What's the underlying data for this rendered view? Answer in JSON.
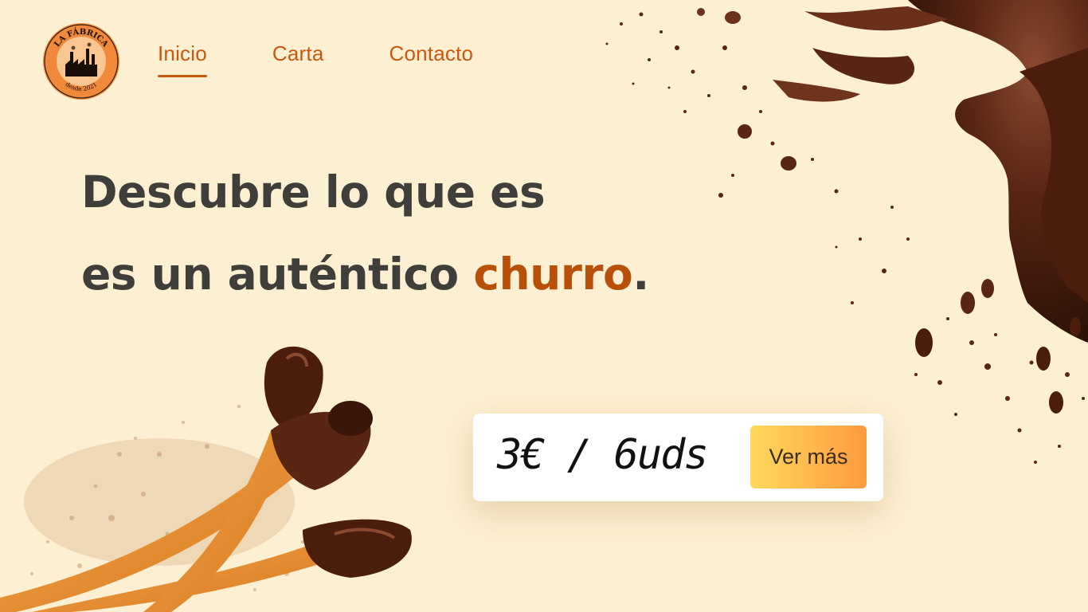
{
  "logo": {
    "top_text": "LA FÁBRICA",
    "bottom_text": "desde 2021",
    "icon": "factory-icon"
  },
  "nav": {
    "items": [
      {
        "label": "Inicio",
        "active": true
      },
      {
        "label": "Carta",
        "active": false
      },
      {
        "label": "Contacto",
        "active": false
      }
    ]
  },
  "hero": {
    "line1": "Descubre lo que es",
    "line2_prefix": "es un auténtico",
    "line2_accent": "churro",
    "line2_suffix": "."
  },
  "offer": {
    "price": "3€ / 6uds",
    "button_label": "Ver más"
  },
  "colors": {
    "background": "#fdefd1",
    "accent": "#c9580f",
    "headline": "#403e3a",
    "button_start": "#ffd95c",
    "button_end": "#ff9a3f"
  }
}
